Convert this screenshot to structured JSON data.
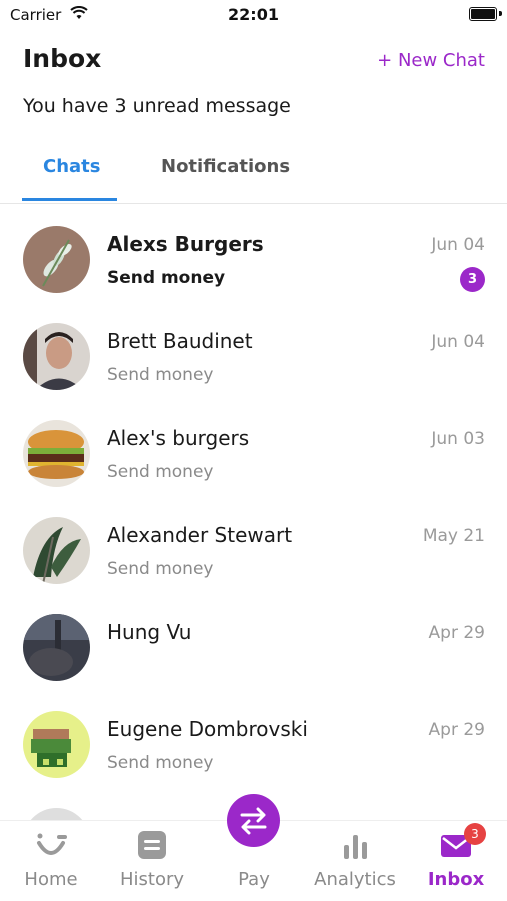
{
  "status_bar": {
    "carrier": "Carrier",
    "time": "22:01"
  },
  "header": {
    "title": "Inbox",
    "new_chat": "+ New Chat"
  },
  "unread_text": "You have 3 unread message",
  "tabs": [
    {
      "label": "Chats",
      "active": true
    },
    {
      "label": "Notifications",
      "active": false
    }
  ],
  "chats": [
    {
      "name": "Alexs Burgers",
      "preview": "Send money",
      "date": "Jun 04",
      "unread": "3"
    },
    {
      "name": "Brett Baudinet",
      "preview": "Send money",
      "date": "Jun 04"
    },
    {
      "name": "Alex's burgers",
      "preview": "Send money",
      "date": "Jun 03"
    },
    {
      "name": "Alexander Stewart",
      "preview": "Send money",
      "date": "May 21"
    },
    {
      "name": "Hung Vu",
      "preview": "",
      "date": "Apr 29"
    },
    {
      "name": "Eugene Dombrovski",
      "preview": "Send money",
      "date": "Apr 29"
    }
  ],
  "bottom_nav": {
    "home": "Home",
    "history": "History",
    "pay": "Pay",
    "analytics": "Analytics",
    "inbox": "Inbox",
    "inbox_badge": "3"
  },
  "colors": {
    "accent": "#9b28c9",
    "tab_active": "#2a86e0",
    "badge_red": "#e64242"
  }
}
